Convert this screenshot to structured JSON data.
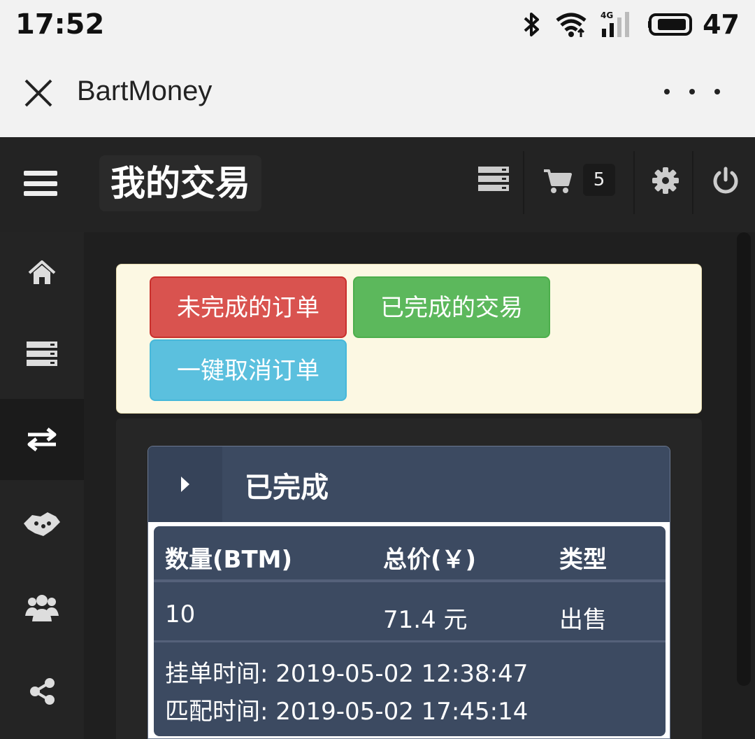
{
  "status_bar": {
    "time": "17:52",
    "network": "4G",
    "battery": "47"
  },
  "app_header": {
    "title": "BartMoney"
  },
  "top_bar": {
    "title": "我的交易",
    "cart_count": "5"
  },
  "buttons": {
    "pending_orders": "未完成的订单",
    "completed_trades": "已完成的交易",
    "cancel_all_orders": "一键取消订单"
  },
  "card": {
    "title": "已完成",
    "table": {
      "headers": [
        "数量(BTM)",
        "总价(￥)",
        "类型"
      ],
      "rows": [
        [
          "10",
          "71.4 元",
          "出售"
        ]
      ]
    },
    "order_time": "挂单时间: 2019-05-02 12:38:47",
    "match_time": "匹配时间: 2019-05-02 17:45:14"
  },
  "colors": {
    "red_button": "#d9534f",
    "green_button": "#5cb85c",
    "blue_button": "#5bc0de",
    "card_bg": "#3c4a61",
    "panel_bg": "#fcf8e3"
  },
  "icons": {
    "sidebar": [
      "home-icon",
      "server-icon",
      "exchange-icon",
      "handshake-icon",
      "users-icon",
      "share-icon"
    ],
    "topbar": [
      "menu-icon",
      "server-icon",
      "cart-icon",
      "gear-icon",
      "power-icon"
    ]
  }
}
